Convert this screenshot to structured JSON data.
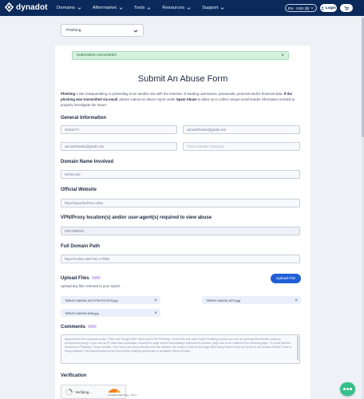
{
  "nav": {
    "logo_text": "dynadot",
    "menu": [
      "Domains",
      "Aftermarket",
      "Tools",
      "Resources",
      "Support"
    ],
    "lang_currency": "EN · USD ($)",
    "login_label": "Login",
    "icons": {
      "logo": "dynadot-logo-icon",
      "user": "user-icon",
      "cart": "cart-icon",
      "chevron": "chevron-down-icon"
    }
  },
  "category_select": {
    "value": "Phishing"
  },
  "alert": {
    "message": "Submission successful!",
    "close": "×"
  },
  "form": {
    "title": "Submit An Abuse Form",
    "intro_bold_1": "Phishing",
    "intro_1": " A site masquerading or pretending to be another site with the intention of stealing usernames, passwords, personal and/or financial data. ",
    "intro_bold_2": "If the phishing was transmitted via email",
    "intro_2": ", please submit an abuse report under ",
    "intro_bold_3": "Spam Abuse",
    "intro_3": " to allow us to collect unique email header information needed to properly investigate the report.",
    "general_info": {
      "heading": "General Information",
      "name": "Global IT+",
      "email": "samuelsheeke@gmail.com",
      "confirm_email": "samuelsheeke@gmail.com",
      "phone_placeholder": "Phone Number (Optional)"
    },
    "domain_involved": {
      "heading": "Domain Name Involved",
      "value": "toshiro.site"
    },
    "official_website": {
      "heading": "Official Website",
      "value": "https://www.thelTwo.online"
    },
    "vpn": {
      "heading": "VPN/Proxy location(s) and/or user-agent(s) required to view abuse",
      "value": "DECOMEDIA"
    },
    "full_path": {
      "heading": "Full Domain Path",
      "value": "https://toshiro.site/?ref=cr7f9d3"
    },
    "upload": {
      "heading": "Upload Files",
      "hint": "Upload any files relevant to your report.",
      "button": "Upload File",
      "files": [
        "TARUS DANSA 1870 PM-SYCD75.jpg",
        "TARUS DANSA 1870.jpg",
        "TARUS DANSA 4W8.jpg"
      ]
    },
    "comments": {
      "heading": "Comments",
      "value": "approached who accounts action. Then use Google AMP cache given the Phishing. I found this site uses Script Cloaking (means you can try opening this domain using an anonymous proxy). If you use an IP other than Indonesia, usually the page will be immediately redirected to another page that is not related to the phishing page. To prove that the domain is a Phishing / Scam domain. Your team can check directly from the domain: the button or link on the page after being clicked does not direct to the domain Global IT but is being phished. Full Indonesia/and in the kind of this phishing perpetrator is available (Direct Break)."
    },
    "verification": {
      "heading": "Verification",
      "status": "Verifying...",
      "provider": "CLOUDFLARE",
      "links": "Privacy · Terms"
    }
  }
}
